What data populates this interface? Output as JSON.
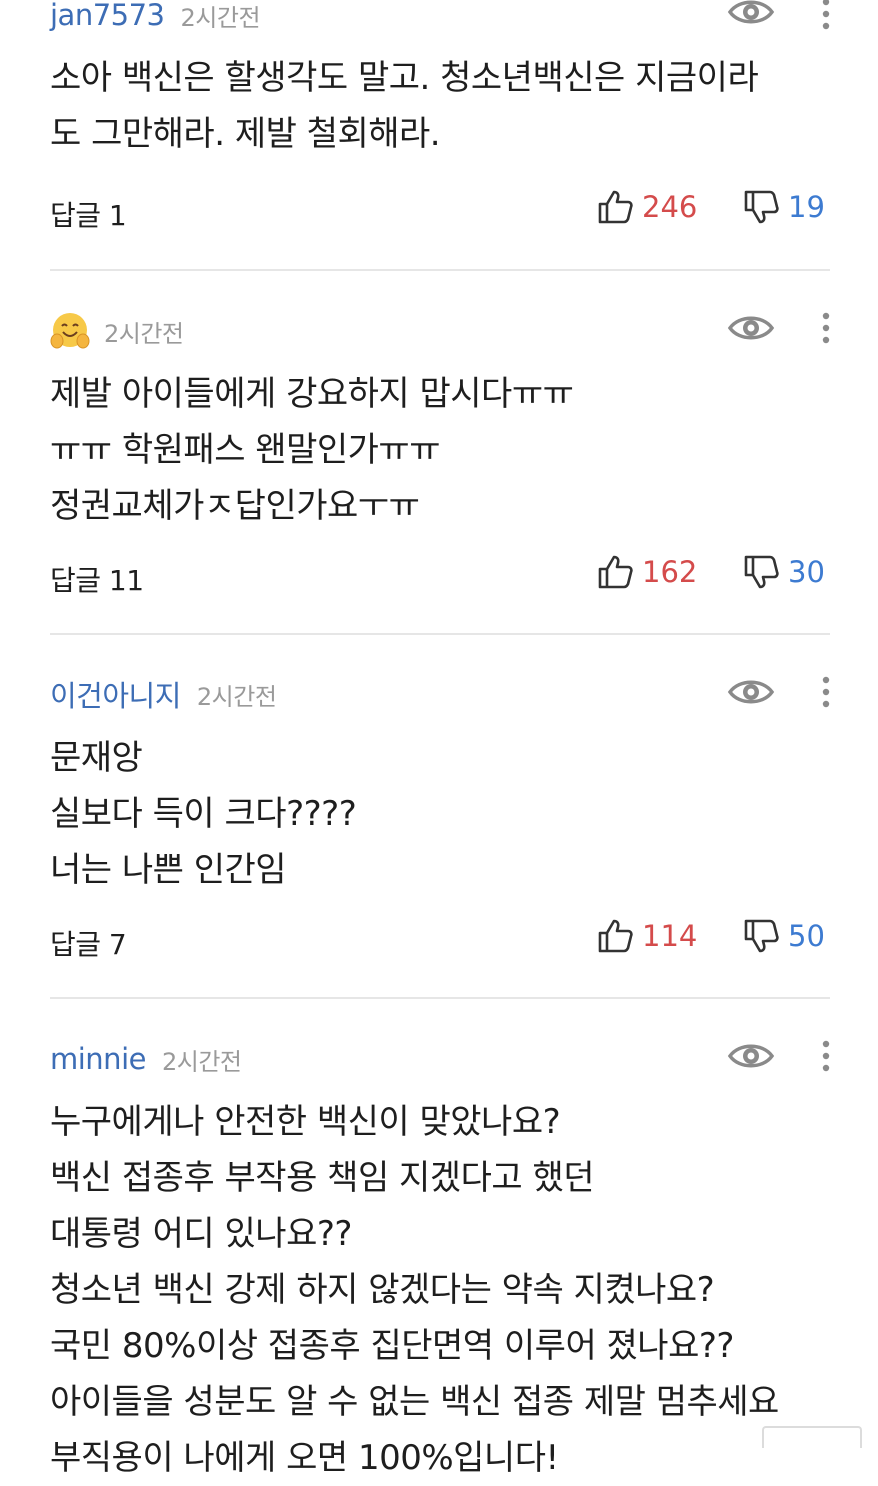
{
  "comments": [
    {
      "username": "jan7573",
      "time": "2시간전",
      "has_avatar": false,
      "lines": [
        "소아 백신은  할생각도 말고.  청소년백신은 지금이라",
        "도 그만해라.  제발 철회해라."
      ],
      "reply_label": "답글 1",
      "likes": "246",
      "dislikes": "19"
    },
    {
      "username": "",
      "time": "2시간전",
      "has_avatar": true,
      "avatar_icon": "hugging-face-emoji-icon",
      "lines": [
        "제발 아이들에게  강요하지 맙시다ㅠㅠ",
        "ㅠㅠ 학원패스 왠말인가ㅠㅠ",
        "정권교체가ㅈ답인가요ㅜㅠ"
      ],
      "reply_label": "답글 11",
      "likes": "162",
      "dislikes": "30"
    },
    {
      "username": "이건아니지",
      "time": "2시간전",
      "has_avatar": false,
      "lines": [
        "문재앙",
        "실보다 득이 크다????",
        "너는 나쁜 인간임"
      ],
      "reply_label": "답글 7",
      "likes": "114",
      "dislikes": "50"
    },
    {
      "username": "minnie",
      "time": "2시간전",
      "has_avatar": false,
      "lines": [
        "누구에게나 안전한 백신이 맞았나요?",
        "백신 접종후 부작용 책임 지겠다고 했던",
        "대통령 어디 있나요??",
        "청소년 백신 강제 하지 않겠다는 약속 지켰나요?",
        "국민 80%이상 접종후  집단면역 이루어 졌나요??",
        "아이들을 성분도 알 수 없는 백신 접종 제말 멈추세요",
        "부직용이 나에게 오면 100%입니다!"
      ]
    }
  ],
  "colors": {
    "username": "#3d6db5",
    "time": "#9a9a9a",
    "like": "#d44b4b",
    "dislike": "#3d7bd1",
    "divider": "#e6e6e6"
  }
}
